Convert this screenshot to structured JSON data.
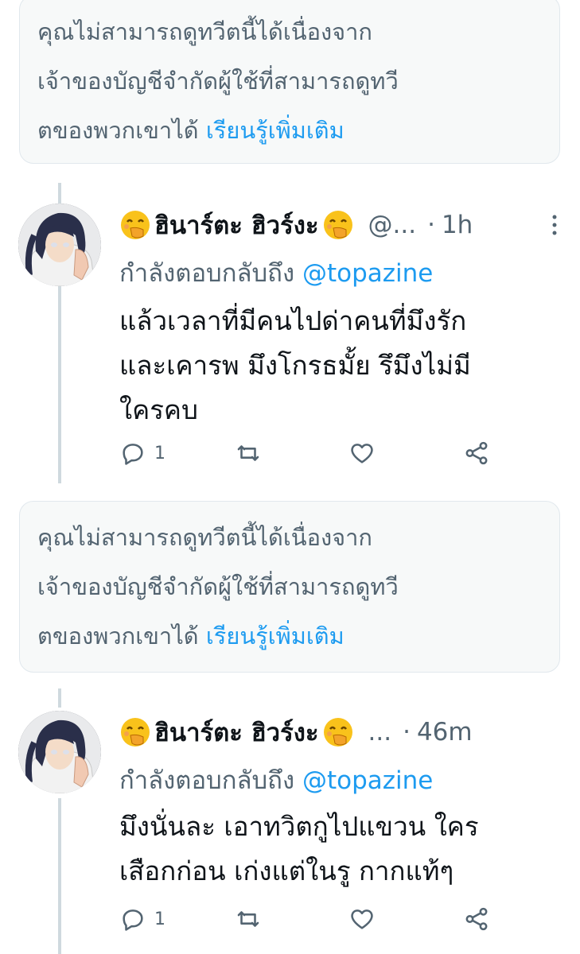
{
  "notices": [
    {
      "line1": "คุณไม่สามารถดูทวีตนี้ได้เนื่องจาก",
      "line2": "เจ้าของบัญชีจำกัดผู้ใช้ที่สามารถดูทวี",
      "line3": "ตของพวกเขาได้",
      "learn_more": "เรียนรู้เพิ่มเติม"
    },
    {
      "line1": "คุณไม่สามารถดูทวีตนี้ได้เนื่องจาก",
      "line2": "เจ้าของบัญชีจำกัดผู้ใช้ที่สามารถดูทวี",
      "line3": "ตของพวกเขาได้",
      "learn_more": "เรียนรู้เพิ่มเติม"
    }
  ],
  "tweets": [
    {
      "name": "ฮินาร์ตะ ฮิวร์งะ",
      "handle": "@...",
      "dot": "·",
      "time": "1h",
      "replying_prefix": "กำลังตอบกลับถึง",
      "mention": "@topazine",
      "lines": [
        "แล้วเวลาที่มีคนไปด่าคนที่มึงรัก",
        "และเคารพ มึงโกรธมั้ย รึมึงไม่มี",
        "ใครคบ"
      ],
      "reply_count": "1",
      "retweet_count": "",
      "like_count": ""
    },
    {
      "name": "ฮินาร์ตะ ฮิวร์งะ",
      "handle": "...",
      "dot": "·",
      "time": "46m",
      "replying_prefix": "กำลังตอบกลับถึง",
      "mention": "@topazine",
      "lines": [
        "มึงนั่นละ เอาทวิตกูไปแขวน ใคร",
        "เสือกก่อน เก่งแต่ในรู กากแท้ๆ"
      ],
      "reply_count": "1",
      "retweet_count": "",
      "like_count": ""
    }
  ],
  "icons": {
    "emoji": "face-with-hand-over-mouth-emoji",
    "reply": "reply-icon",
    "retweet": "retweet-icon",
    "like": "heart-icon",
    "share": "share-icon",
    "more": "more-icon"
  },
  "colors": {
    "accent": "#1d9bf0",
    "secondary_text": "#536471",
    "primary_text": "#0f1419",
    "notice_bg": "#f7f9f9",
    "thread_line": "#cfd9de"
  }
}
